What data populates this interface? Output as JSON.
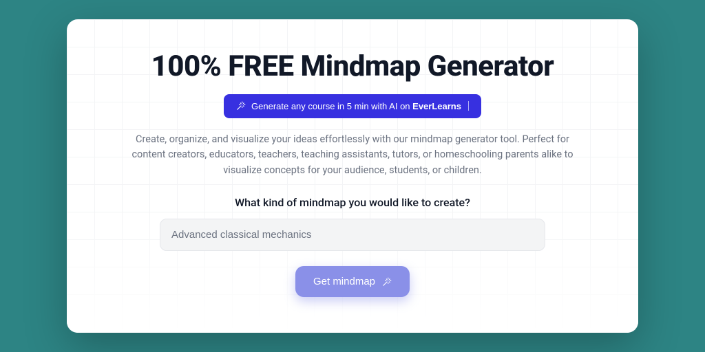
{
  "header": {
    "title": "100% FREE Mindmap Generator"
  },
  "promo": {
    "prefix": "Generate any course in 5 min with AI on ",
    "brand": "EverLearns"
  },
  "description": "Create, organize, and visualize your ideas effortlessly with our mindmap generator tool. Perfect for content creators, educators, teachers, teaching assistants, tutors, or homeschooling parents alike to visualize concepts for your audience, students, or children.",
  "form": {
    "prompt_label": "What kind of mindmap you would like to create?",
    "input_value": "Advanced classical mechanics",
    "input_placeholder": "Advanced classical mechanics",
    "cta_label": "Get mindmap"
  }
}
